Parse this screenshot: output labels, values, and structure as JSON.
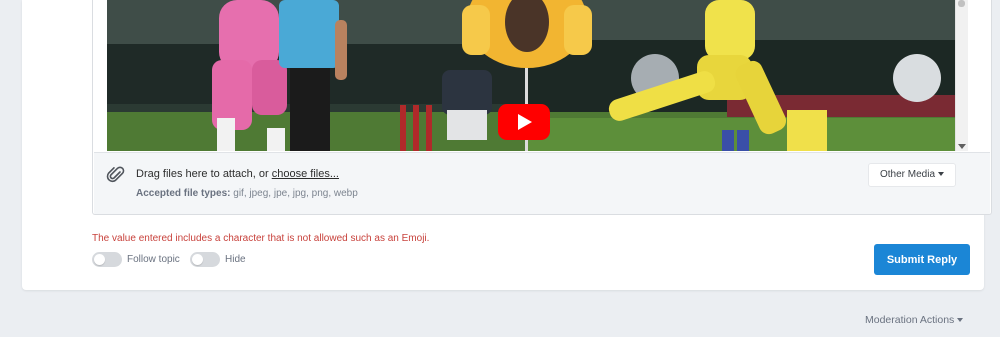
{
  "attachments": {
    "drag_text": "Drag files here to attach, or ",
    "choose_files": "choose files...",
    "accepted_label": "Accepted file types:",
    "accepted_types": "gif, jpeg, jpe, jpg, png, webp",
    "other_media": "Other Media"
  },
  "video": {
    "thumbnail_description": "Embedded YouTube video thumbnail (cricket players, shocked emoji)",
    "play_icon": "youtube-play-icon"
  },
  "form": {
    "error": "The value entered includes a character that is not allowed such as an Emoji.",
    "follow_topic": "Follow topic",
    "hide": "Hide",
    "submit": "Submit Reply"
  },
  "footer": {
    "moderation_actions": "Moderation Actions"
  },
  "colors": {
    "submit": "#1b86d6",
    "error": "#c8423c",
    "youtube_red": "#ff0000"
  }
}
